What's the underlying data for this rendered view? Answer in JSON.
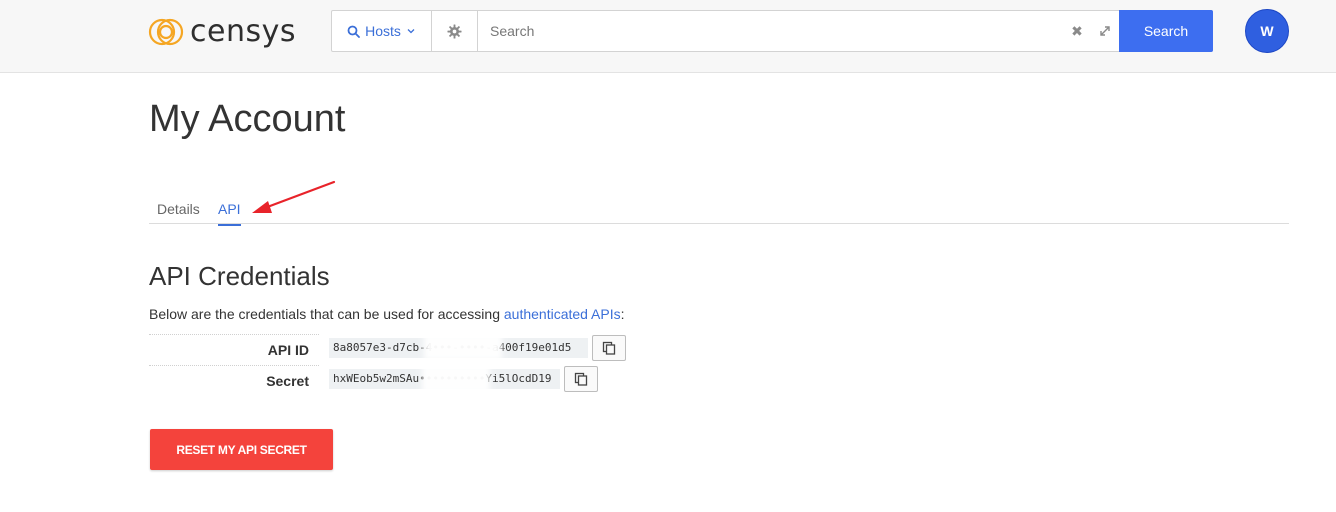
{
  "brand": {
    "name": "censys",
    "color": "#f5a623"
  },
  "search": {
    "scope_label": "Hosts",
    "placeholder": "Search",
    "button_label": "Search"
  },
  "user": {
    "initial": "W",
    "avatar_color": "#2f5fe0"
  },
  "page": {
    "title": "My Account"
  },
  "tabs": [
    {
      "label": "Details",
      "active": false
    },
    {
      "label": "API",
      "active": true
    }
  ],
  "credentials": {
    "title": "API Credentials",
    "description_prefix": "Below are the credentials that can be used for accessing ",
    "description_link": "authenticated APIs",
    "description_suffix": ":",
    "api_id_label": "API ID",
    "api_id_value": "8a8057e3-d7cb-4•••-••••-a400f19e01d5",
    "secret_label": "Secret",
    "secret_value": "hxWEob5w2mSAu••••••••••Yi5lOcdD19"
  },
  "actions": {
    "reset_label": "RESET MY API SECRET"
  },
  "colors": {
    "accent": "#3d6ef0",
    "danger": "#f4433c",
    "link": "#3b6fd8"
  }
}
